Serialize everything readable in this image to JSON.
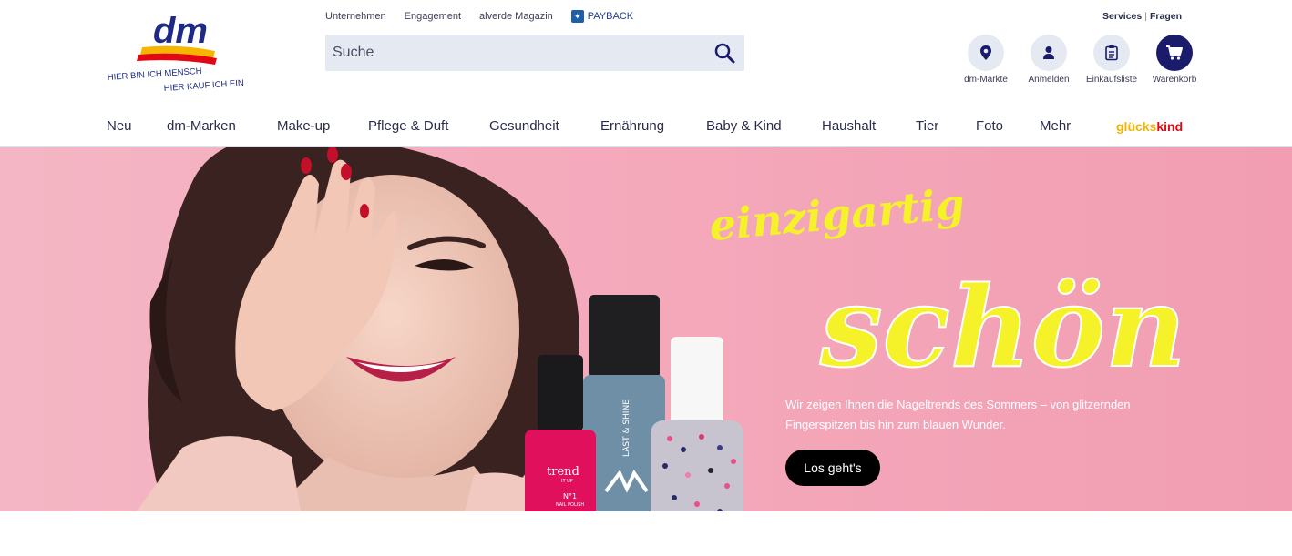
{
  "brand": {
    "name": "dm",
    "slogan_line1": "HIER BIN ICH MENSCH",
    "slogan_line2": "HIER KAUF ICH EIN"
  },
  "toplinks": [
    "Unternehmen",
    "Engagement",
    "alverde Magazin",
    "PAYBACK"
  ],
  "services": {
    "services_label": "Services",
    "fragen_label": "Fragen",
    "separator": "|"
  },
  "search": {
    "placeholder": "Suche"
  },
  "header_icons": [
    {
      "label": "dm-Märkte",
      "icon": "location-pin-icon"
    },
    {
      "label": "Anmelden",
      "icon": "user-icon"
    },
    {
      "label": "Einkaufsliste",
      "icon": "clipboard-icon"
    },
    {
      "label": "Warenkorb",
      "icon": "cart-icon"
    }
  ],
  "nav": [
    "Neu",
    "dm-Marken",
    "Make-up",
    "Pflege & Duft",
    "Gesundheit",
    "Ernährung",
    "Baby & Kind",
    "Haushalt",
    "Tier",
    "Foto",
    "Mehr"
  ],
  "glueckskind": {
    "part1": "glücks",
    "part2": "kind"
  },
  "hero": {
    "headline_small": "einzigartig",
    "headline_big": "schön",
    "text": "Wir zeigen Ihnen die Nageltrends des Sommers – von glitzernden Fingerspitzen bis hin zum blauen Wunder.",
    "button": "Los geht's",
    "bottle1_brand": "trend",
    "bottle1_sub": "IT UP",
    "bottle1_no": "N°1",
    "bottle1_label": "NAIL POLISH",
    "bottle2_label": "LAST & SHINE",
    "bottle2_brand": "MANHATTAN"
  },
  "colors": {
    "accent_dark": "#1a1b6b",
    "search_bg": "#e4e9f2",
    "hero_pink": "#f4a9bb",
    "headline_yellow": "#f6f22a",
    "brand_red": "#e30613"
  }
}
